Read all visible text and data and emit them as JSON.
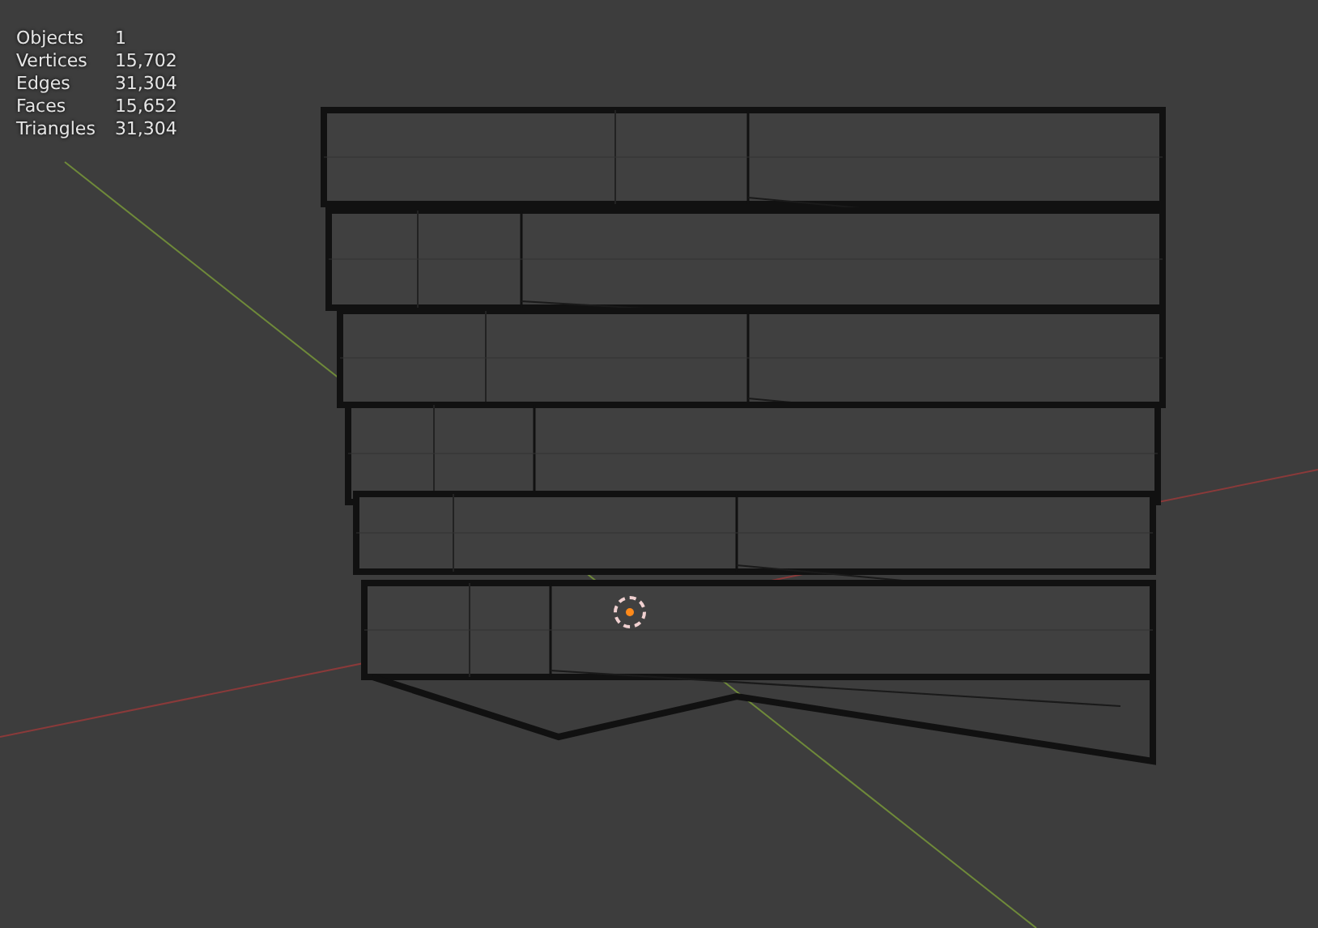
{
  "stats": [
    {
      "label": "Objects",
      "value": "1"
    },
    {
      "label": "Vertices",
      "value": "15,702"
    },
    {
      "label": "Edges",
      "value": "31,304"
    },
    {
      "label": "Faces",
      "value": "15,652"
    },
    {
      "label": "Triangles",
      "value": "31,304"
    }
  ]
}
